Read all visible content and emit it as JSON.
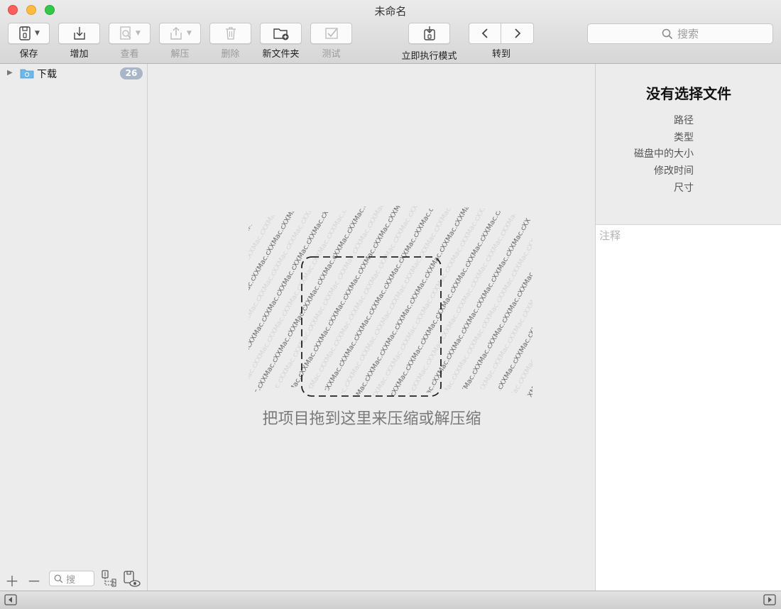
{
  "window": {
    "title": "未命名"
  },
  "toolbar": {
    "save_label": "保存",
    "add_label": "增加",
    "view_label": "查看",
    "extract_label": "解压",
    "delete_label": "删除",
    "new_folder_label": "新文件夹",
    "test_label": "测试",
    "immediate_mode_label": "立即执行模式",
    "goto_label": "转到",
    "search_placeholder": "搜索"
  },
  "sidebar": {
    "items": [
      {
        "label": "下载",
        "count": "26",
        "icon": "folder-icon"
      }
    ],
    "search_placeholder": "搜"
  },
  "main": {
    "drop_hint": "把项目拖到这里来压缩或解压缩",
    "watermark": "XXMac.com"
  },
  "inspector": {
    "title": "没有选择文件",
    "fields": [
      "路径",
      "类型",
      "磁盘中的大小",
      "修改时间",
      "尺寸"
    ],
    "notes_placeholder": "注释"
  },
  "colors": {
    "badge": "#a9b6c8",
    "close": "#fc605c",
    "minimize": "#fdbc40",
    "zoom": "#34c84a"
  }
}
